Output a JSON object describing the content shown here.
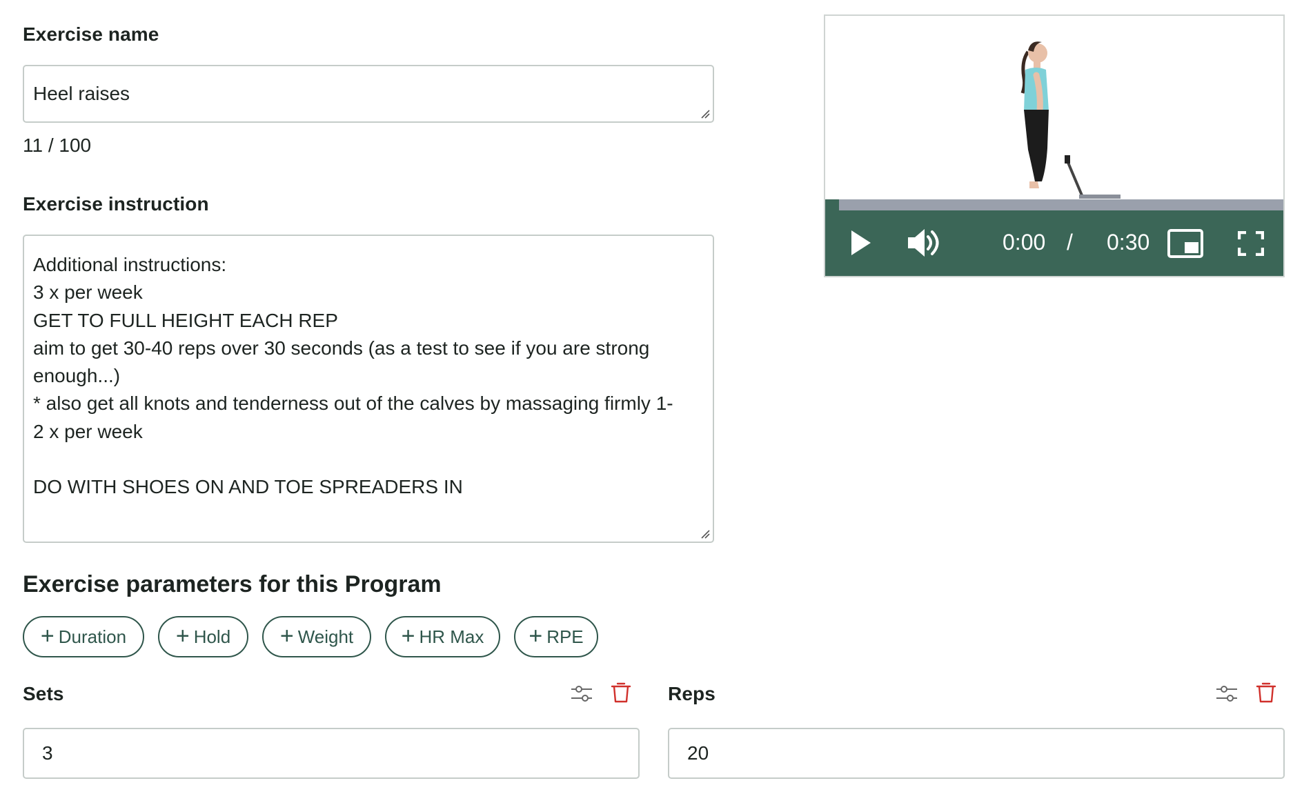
{
  "exercise_name": {
    "label": "Exercise name",
    "value": "Heel raises",
    "counter": "11 / 100"
  },
  "exercise_instruction": {
    "label": "Exercise instruction",
    "lines": [
      "Additional instructions:",
      "3 x per week",
      "GET TO FULL HEIGHT EACH REP",
      "aim to get 30-40 reps over 30 seconds (as a test to see if you are strong",
      "enough...)",
      "* also get all knots and tenderness out of the calves by massaging firmly 1-",
      "2 x per week",
      "",
      "DO WITH SHOES ON AND TOE SPREADERS IN"
    ]
  },
  "parameters": {
    "title": "Exercise parameters for this Program",
    "add_buttons": [
      "Duration",
      "Hold",
      "Weight",
      "HR Max",
      "RPE"
    ],
    "fields": [
      {
        "label": "Sets",
        "value": "3"
      },
      {
        "label": "Reps",
        "value": "20"
      }
    ]
  },
  "video": {
    "current_time": "0:00",
    "separator": "/",
    "duration": "0:30",
    "icons": [
      "play-icon",
      "volume-icon",
      "picture-in-picture-icon",
      "fullscreen-icon"
    ]
  },
  "colors": {
    "accent": "#2f564b",
    "video_controls": "#3b6657",
    "delete": "#d0302b",
    "border": "#c5ccc9"
  }
}
